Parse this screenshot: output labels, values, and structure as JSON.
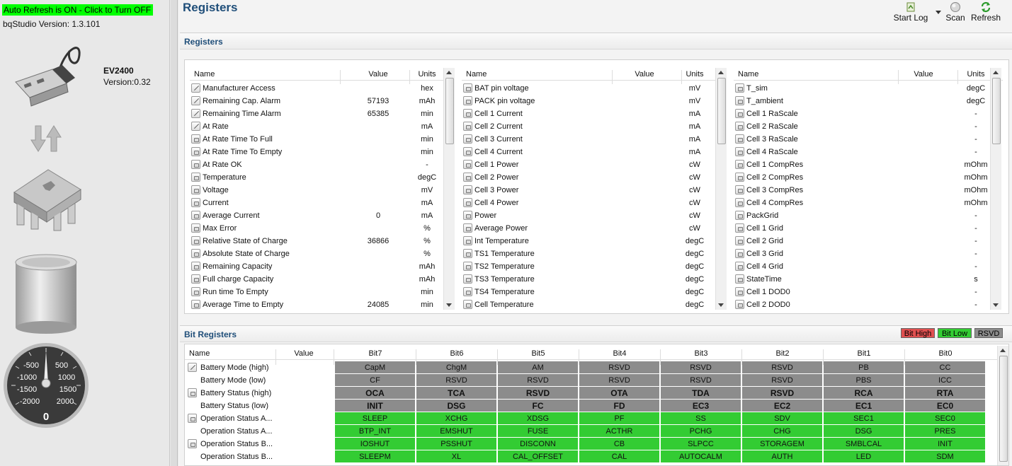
{
  "left": {
    "auto_refresh": "Auto Refresh is ON - Click to Turn OFF",
    "bq_version": "bqStudio Version:  1.3.101",
    "device_name": "EV2400",
    "device_version": "Version:0.32",
    "gauge_labels": [
      "-500",
      "500",
      "-1000",
      "1000",
      "-1500",
      "1500",
      "-2000",
      "2000"
    ],
    "gauge_value": "0"
  },
  "main": {
    "title": "Registers",
    "toolbar": {
      "start_log": "Start Log",
      "scan": "Scan",
      "refresh": "Refresh"
    }
  },
  "registers_section": {
    "title": "Registers"
  },
  "columns": {
    "name": "Name",
    "value": "Value",
    "units": "Units"
  },
  "grid1": [
    {
      "icon": "edit",
      "name": "Manufacturer Access",
      "value": "",
      "units": "hex"
    },
    {
      "icon": "edit",
      "name": "Remaining Cap. Alarm",
      "value": "57193",
      "units": "mAh"
    },
    {
      "icon": "edit",
      "name": "Remaining Time Alarm",
      "value": "65385",
      "units": "min"
    },
    {
      "icon": "edit",
      "name": "At Rate",
      "value": "",
      "units": "mA"
    },
    {
      "icon": "lock",
      "name": "At Rate Time To Full",
      "value": "",
      "units": "min"
    },
    {
      "icon": "lock",
      "name": "At Rate Time To Empty",
      "value": "",
      "units": "min"
    },
    {
      "icon": "lock",
      "name": "At Rate OK",
      "value": "",
      "units": "-"
    },
    {
      "icon": "lock",
      "name": "Temperature",
      "value": "",
      "units": "degC"
    },
    {
      "icon": "lock",
      "name": "Voltage",
      "value": "",
      "units": "mV"
    },
    {
      "icon": "lock",
      "name": "Current",
      "value": "",
      "units": "mA"
    },
    {
      "icon": "lock",
      "name": "Average Current",
      "value": "0",
      "units": "mA"
    },
    {
      "icon": "lock",
      "name": "Max Error",
      "value": "",
      "units": "%"
    },
    {
      "icon": "lock",
      "name": "Relative State of Charge",
      "value": "36866",
      "units": "%"
    },
    {
      "icon": "lock",
      "name": "Absolute State of Charge",
      "value": "",
      "units": "%"
    },
    {
      "icon": "lock",
      "name": "Remaining Capacity",
      "value": "",
      "units": "mAh"
    },
    {
      "icon": "lock",
      "name": "Full charge Capacity",
      "value": "",
      "units": "mAh"
    },
    {
      "icon": "lock",
      "name": "Run time To Empty",
      "value": "",
      "units": "min"
    },
    {
      "icon": "lock",
      "name": "Average Time to Empty",
      "value": "24085",
      "units": "min"
    }
  ],
  "grid2": [
    {
      "icon": "lock",
      "name": "BAT pin voltage",
      "value": "",
      "units": "mV"
    },
    {
      "icon": "lock",
      "name": "PACK pin voltage",
      "value": "",
      "units": "mV"
    },
    {
      "icon": "lock",
      "name": "Cell 1 Current",
      "value": "",
      "units": "mA"
    },
    {
      "icon": "lock",
      "name": "Cell 2 Current",
      "value": "",
      "units": "mA"
    },
    {
      "icon": "lock",
      "name": "Cell 3 Current",
      "value": "",
      "units": "mA"
    },
    {
      "icon": "lock",
      "name": "Cell 4 Current",
      "value": "",
      "units": "mA"
    },
    {
      "icon": "lock",
      "name": "Cell 1 Power",
      "value": "",
      "units": "cW"
    },
    {
      "icon": "lock",
      "name": "Cell 2 Power",
      "value": "",
      "units": "cW"
    },
    {
      "icon": "lock",
      "name": "Cell 3 Power",
      "value": "",
      "units": "cW"
    },
    {
      "icon": "lock",
      "name": "Cell 4 Power",
      "value": "",
      "units": "cW"
    },
    {
      "icon": "lock",
      "name": "Power",
      "value": "",
      "units": "cW"
    },
    {
      "icon": "lock",
      "name": "Average Power",
      "value": "",
      "units": "cW"
    },
    {
      "icon": "lock",
      "name": "Int Temperature",
      "value": "",
      "units": "degC"
    },
    {
      "icon": "lock",
      "name": "TS1 Temperature",
      "value": "",
      "units": "degC"
    },
    {
      "icon": "lock",
      "name": "TS2 Temperature",
      "value": "",
      "units": "degC"
    },
    {
      "icon": "lock",
      "name": "TS3 Temperature",
      "value": "",
      "units": "degC"
    },
    {
      "icon": "lock",
      "name": "TS4 Temperature",
      "value": "",
      "units": "degC"
    },
    {
      "icon": "lock",
      "name": "Cell Temperature",
      "value": "",
      "units": "degC"
    }
  ],
  "grid3": [
    {
      "icon": "lock",
      "name": "T_sim",
      "value": "",
      "units": "degC"
    },
    {
      "icon": "lock",
      "name": "T_ambient",
      "value": "",
      "units": "degC"
    },
    {
      "icon": "lock",
      "name": "Cell 1 RaScale",
      "value": "",
      "units": "-"
    },
    {
      "icon": "lock",
      "name": "Cell 2 RaScale",
      "value": "",
      "units": "-"
    },
    {
      "icon": "lock",
      "name": "Cell 3 RaScale",
      "value": "",
      "units": "-"
    },
    {
      "icon": "lock",
      "name": "Cell 4 RaScale",
      "value": "",
      "units": "-"
    },
    {
      "icon": "lock",
      "name": "Cell 1 CompRes",
      "value": "",
      "units": "mOhm"
    },
    {
      "icon": "lock",
      "name": "Cell 2 CompRes",
      "value": "",
      "units": "mOhm"
    },
    {
      "icon": "lock",
      "name": "Cell 3 CompRes",
      "value": "",
      "units": "mOhm"
    },
    {
      "icon": "lock",
      "name": "Cell 4 CompRes",
      "value": "",
      "units": "mOhm"
    },
    {
      "icon": "lock",
      "name": "PackGrid",
      "value": "",
      "units": "-"
    },
    {
      "icon": "lock",
      "name": "Cell 1 Grid",
      "value": "",
      "units": "-"
    },
    {
      "icon": "lock",
      "name": "Cell 2 Grid",
      "value": "",
      "units": "-"
    },
    {
      "icon": "lock",
      "name": "Cell 3 Grid",
      "value": "",
      "units": "-"
    },
    {
      "icon": "lock",
      "name": "Cell 4 Grid",
      "value": "",
      "units": "-"
    },
    {
      "icon": "lock",
      "name": "StateTime",
      "value": "",
      "units": "s"
    },
    {
      "icon": "lock",
      "name": "Cell 1 DOD0",
      "value": "",
      "units": "-"
    },
    {
      "icon": "lock",
      "name": "Cell 2 DOD0",
      "value": "",
      "units": "-"
    }
  ],
  "bit_section": {
    "title": "Bit Registers",
    "legend": {
      "high": "Bit High",
      "low": "Bit Low",
      "rsvd": "RSVD"
    },
    "colors": {
      "high": "#e05050",
      "low": "#33cc33",
      "rsvd": "#8c8c8c"
    },
    "headers": [
      "Name",
      "Value",
      "Bit7",
      "Bit6",
      "Bit5",
      "Bit4",
      "Bit3",
      "Bit2",
      "Bit1",
      "Bit0"
    ],
    "rows": [
      {
        "icon": "edit",
        "name": "Battery Mode (high)",
        "state": "rsvd",
        "bold": false,
        "bits": [
          "CapM",
          "ChgM",
          "AM",
          "RSVD",
          "RSVD",
          "RSVD",
          "PB",
          "CC"
        ]
      },
      {
        "icon": "",
        "name": "Battery Mode (low)",
        "state": "rsvd",
        "bold": false,
        "bits": [
          "CF",
          "RSVD",
          "RSVD",
          "RSVD",
          "RSVD",
          "RSVD",
          "PBS",
          "ICC"
        ]
      },
      {
        "icon": "lock",
        "name": "Battery Status (high)",
        "state": "rsvd",
        "bold": true,
        "bits": [
          "OCA",
          "TCA",
          "RSVD",
          "OTA",
          "TDA",
          "RSVD",
          "RCA",
          "RTA"
        ]
      },
      {
        "icon": "",
        "name": "Battery Status (low)",
        "state": "rsvd",
        "bold": true,
        "bits": [
          "INIT",
          "DSG",
          "FC",
          "FD",
          "EC3",
          "EC2",
          "EC1",
          "EC0"
        ]
      },
      {
        "icon": "lock",
        "name": "Operation Status A...",
        "state": "low",
        "bold": false,
        "bits": [
          "SLEEP",
          "XCHG",
          "XDSG",
          "PF",
          "SS",
          "SDV",
          "SEC1",
          "SEC0"
        ]
      },
      {
        "icon": "",
        "name": "Operation Status A...",
        "state": "low",
        "bold": false,
        "bits": [
          "BTP_INT",
          "EMSHUT",
          "FUSE",
          "ACTHR",
          "PCHG",
          "CHG",
          "DSG",
          "PRES"
        ]
      },
      {
        "icon": "lock",
        "name": "Operation Status B...",
        "state": "low",
        "bold": false,
        "bits": [
          "IOSHUT",
          "PSSHUT",
          "DISCONN",
          "CB",
          "SLPCC",
          "STORAGEM",
          "SMBLCAL",
          "INIT"
        ]
      },
      {
        "icon": "",
        "name": "Operation Status B...",
        "state": "low",
        "bold": false,
        "bits": [
          "SLEEPM",
          "XL",
          "CAL_OFFSET",
          "CAL",
          "AUTOCALM",
          "AUTH",
          "LED",
          "SDM"
        ]
      }
    ]
  }
}
